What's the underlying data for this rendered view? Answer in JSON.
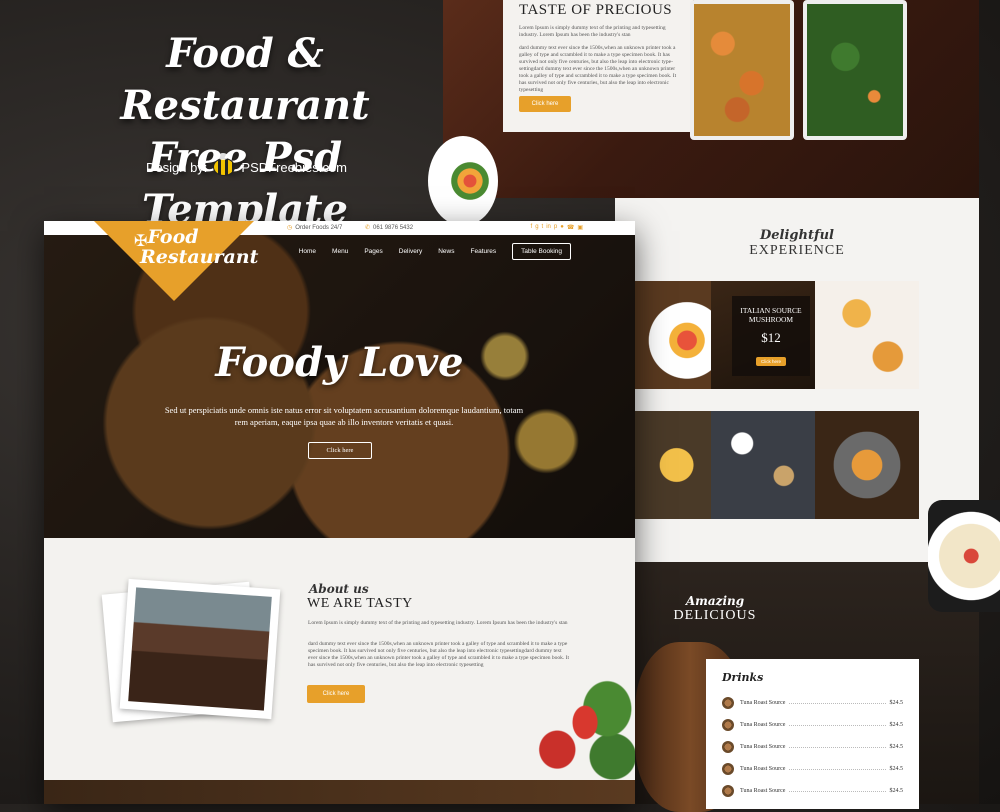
{
  "promo": {
    "title_line1": "Food & Restaurant",
    "title_line2": "Free Psd Template",
    "credit_label": "Design by:",
    "credit_brand": "PSDFreebies.com"
  },
  "back_page": {
    "taste": {
      "title": "TASTE OF PRECIOUS",
      "text1": "Lorem Ipsum is simply dummy text of the printing and typesetting industry. Lorem Ipsum has been the industry's stan",
      "text2": "dard dummy text ever since the 1500s,when an unknown printer took a galley of type and scrambled it to make a type specimen book. It has survived not only five centuries, but also the leap into electronic type-settingdard dummy text ever since the 1500s,when an unknown printer took a galley of type and scrambled it to make a type specimen book. It has survived not only five centuries, but also the leap into electronic typesetting",
      "button": "Click here"
    },
    "experience": {
      "script": "Delightful",
      "title": "EXPERIENCE",
      "special_name": "ITALIAN SOURCE MUSHROOM",
      "special_price": "$12",
      "special_button": "Click here"
    },
    "delicious": {
      "script": "Amazing",
      "title": "DELICIOUS"
    },
    "drinks": {
      "title": "Drinks",
      "items": [
        {
          "name": "Tuna Roast Source",
          "price": "$24.5"
        },
        {
          "name": "Tuna Roast Source",
          "price": "$24.5"
        },
        {
          "name": "Tuna Roast Source",
          "price": "$24.5"
        },
        {
          "name": "Tuna Roast Source",
          "price": "$24.5"
        },
        {
          "name": "Tuna Roast Source",
          "price": "$24.5"
        }
      ]
    }
  },
  "front_page": {
    "topbar": {
      "order": "Order Foods 24/7",
      "phone": "061 9876 5432"
    },
    "logo": {
      "name": "Food",
      "sub": "Restaurant"
    },
    "nav": [
      "Home",
      "Menu",
      "Pages",
      "Delivery",
      "News",
      "Features"
    ],
    "nav_button": "Table Booking",
    "hero": {
      "title": "Foody Love",
      "text": "Sed ut perspiciatis unde omnis iste natus error sit voluptatem accusantium doloremque laudantium, totam rem aperiam, eaque ipsa quae ab illo inventore veritatis et quasi.",
      "button": "Click here"
    },
    "about": {
      "script": "About us",
      "title": "WE ARE TASTY",
      "text1": "Lorem Ipsum is simply dummy text of the printing and typesetting industry. Lorem Ipsum has been the industry's stan",
      "text2": "dard dummy text ever since the 1500s,when an unknown printer took a galley of type and scrambled it to make a type specimen book. It has survived not only five centuries, but also the leap into electronic typesettingdard dummy text ever since the 1500s,when an unknown printer took a galley of type and scrambled it to make a type specimen book. It has survived not only five centuries, but also the leap into electronic typesetting",
      "button": "Click here"
    }
  },
  "colors": {
    "accent": "#e7a02a",
    "dark_bg": "#1f1c1a"
  }
}
